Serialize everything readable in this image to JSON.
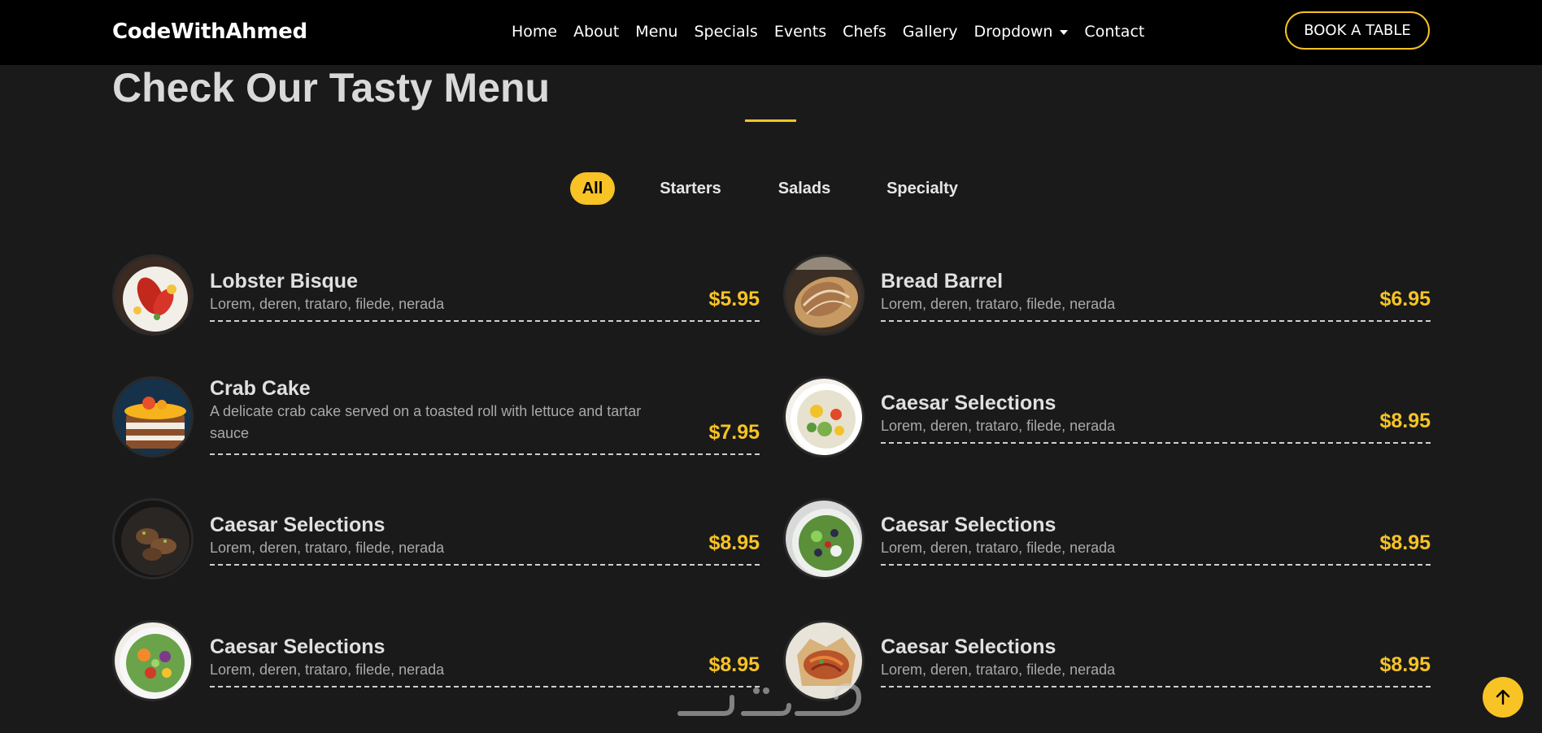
{
  "brand": "CodeWithAhmed",
  "nav": {
    "items": [
      "Home",
      "About",
      "Menu",
      "Specials",
      "Events",
      "Chefs",
      "Gallery",
      "Dropdown",
      "Contact"
    ],
    "cta": "BOOK A TABLE"
  },
  "section": {
    "title": "Check Our Tasty Menu"
  },
  "tabs": [
    "All",
    "Starters",
    "Salads",
    "Specialty"
  ],
  "active_tab": "All",
  "menu": [
    {
      "name": "Lobster Bisque",
      "desc": "Lorem, deren, trataro, filede, nerada",
      "price": "$5.95",
      "image": "lobster-plate"
    },
    {
      "name": "Bread Barrel",
      "desc": "Lorem, deren, trataro, filede, nerada",
      "price": "$6.95",
      "image": "bread-loaf"
    },
    {
      "name": "Crab Cake",
      "desc": "A delicate crab cake served on a toasted roll with lettuce and tartar sauce",
      "price": "$7.95",
      "image": "layer-cake"
    },
    {
      "name": "Caesar Selections",
      "desc": "Lorem, deren, trataro, filede, nerada",
      "price": "$8.95",
      "image": "salad-bowl"
    },
    {
      "name": "Caesar Selections",
      "desc": "Lorem, deren, trataro, filede, nerada",
      "price": "$8.95",
      "image": "grilled-meat"
    },
    {
      "name": "Caesar Selections",
      "desc": "Lorem, deren, trataro, filede, nerada",
      "price": "$8.95",
      "image": "green-salad"
    },
    {
      "name": "Caesar Selections",
      "desc": "Lorem, deren, trataro, filede, nerada",
      "price": "$8.95",
      "image": "veggie-salad"
    },
    {
      "name": "Caesar Selections",
      "desc": "Lorem, deren, trataro, filede, nerada",
      "price": "$8.95",
      "image": "noodle-basket"
    }
  ],
  "colors": {
    "accent": "#f7c325",
    "background": "#1a1a1a",
    "navbar": "#000000"
  },
  "icons": {
    "scroll_top": "arrow-up-icon"
  }
}
